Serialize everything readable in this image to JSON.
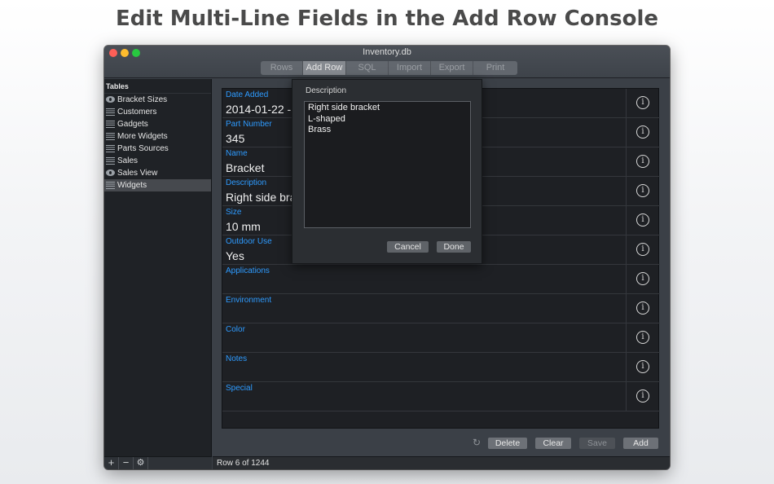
{
  "headline": "Edit Multi-Line Fields in the Add Row Console",
  "window": {
    "title": "Inventory.db",
    "tabs": [
      "Rows",
      "Add Row",
      "SQL",
      "Import",
      "Export",
      "Print"
    ],
    "active_tab": "Add Row"
  },
  "sidebar": {
    "header": "Tables",
    "items": [
      {
        "label": "Bracket Sizes",
        "icon": "eye-icon"
      },
      {
        "label": "Customers",
        "icon": "table-icon"
      },
      {
        "label": "Gadgets",
        "icon": "table-icon"
      },
      {
        "label": "More Widgets",
        "icon": "table-icon"
      },
      {
        "label": "Parts Sources",
        "icon": "table-icon"
      },
      {
        "label": "Sales",
        "icon": "table-icon"
      },
      {
        "label": "Sales View",
        "icon": "eye-icon"
      },
      {
        "label": "Widgets",
        "icon": "table-icon"
      }
    ],
    "selected": "Widgets",
    "footer_buttons": [
      "+",
      "−",
      "⚙"
    ]
  },
  "form": {
    "fields": [
      {
        "label": "Date Added",
        "value": "2014-01-22 -"
      },
      {
        "label": "Part Number",
        "value": "345"
      },
      {
        "label": "Name",
        "value": "Bracket"
      },
      {
        "label": "Description",
        "value": "Right side bracket"
      },
      {
        "label": "Size",
        "value": "10 mm"
      },
      {
        "label": "Outdoor Use",
        "value": "Yes"
      },
      {
        "label": "Applications",
        "value": ""
      },
      {
        "label": "Environment",
        "value": ""
      },
      {
        "label": "Color",
        "value": ""
      },
      {
        "label": "Notes",
        "value": ""
      },
      {
        "label": "Special",
        "value": ""
      }
    ],
    "info_glyph": "i"
  },
  "actions": {
    "refresh_glyph": "↻",
    "delete": "Delete",
    "clear": "Clear",
    "save": "Save",
    "add": "Add"
  },
  "status": "Row 6 of 1244",
  "popover": {
    "title": "Description",
    "lines": [
      "Right side bracket",
      "L-shaped",
      "Brass"
    ],
    "cancel": "Cancel",
    "done": "Done"
  }
}
